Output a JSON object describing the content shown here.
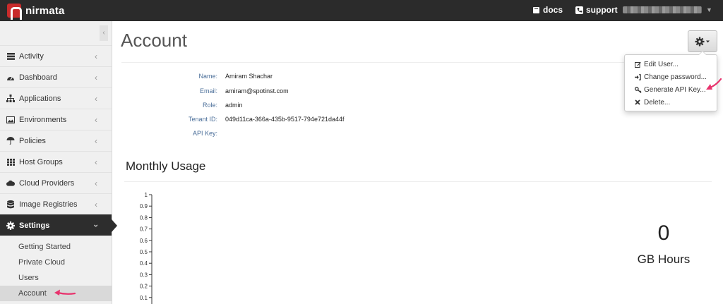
{
  "app": {
    "brand": "nirmata"
  },
  "topbar": {
    "docs_label": "docs",
    "support_label": "support",
    "user_name": "",
    "user_icon": "caret-down-icon"
  },
  "sidebar": {
    "items": [
      {
        "label": "Activity",
        "icon": "list-icon"
      },
      {
        "label": "Dashboard",
        "icon": "dashboard-icon"
      },
      {
        "label": "Applications",
        "icon": "sitemap-icon"
      },
      {
        "label": "Environments",
        "icon": "image-icon"
      },
      {
        "label": "Policies",
        "icon": "umbrella-icon"
      },
      {
        "label": "Host Groups",
        "icon": "grid-icon"
      },
      {
        "label": "Cloud Providers",
        "icon": "cloud-icon"
      },
      {
        "label": "Image Registries",
        "icon": "database-icon"
      },
      {
        "label": "Settings",
        "icon": "gear-icon",
        "active": true
      }
    ],
    "subitems": [
      {
        "label": "Getting Started"
      },
      {
        "label": "Private Cloud"
      },
      {
        "label": "Users"
      },
      {
        "label": "Account",
        "current": true
      }
    ]
  },
  "main": {
    "title": "Account",
    "account": {
      "name_label": "Name:",
      "name_value": "Amiram Shachar",
      "email_label": "Email:",
      "email_value": "amiram@spotinst.com",
      "role_label": "Role:",
      "role_value": "admin",
      "tenant_label": "Tenant ID:",
      "tenant_value": "049d11ca-366a-435b-9517-794e721da44f",
      "apikey_label": "API Key:",
      "apikey_value": ""
    },
    "actions_menu": {
      "items": [
        {
          "label": "Edit User...",
          "icon": "edit-icon"
        },
        {
          "label": "Change password...",
          "icon": "sign-in-icon"
        },
        {
          "label": "Generate API Key...",
          "icon": "key-icon"
        },
        {
          "label": "Delete...",
          "icon": "close-icon"
        }
      ]
    },
    "usage": {
      "title": "Monthly Usage",
      "total_value": "0",
      "total_unit": "GB Hours"
    }
  },
  "colors": {
    "annotation_arrow": "#e8336d",
    "topbar": "#2b2b2b",
    "active_nav": "#2d2d2d"
  },
  "chart_data": {
    "type": "line",
    "ylim": [
      0,
      1
    ],
    "yticks": [
      "1",
      "0.9",
      "0.8",
      "0.7",
      "0.6",
      "0.5",
      "0.4",
      "0.3",
      "0.2",
      "0.1"
    ],
    "series": []
  }
}
